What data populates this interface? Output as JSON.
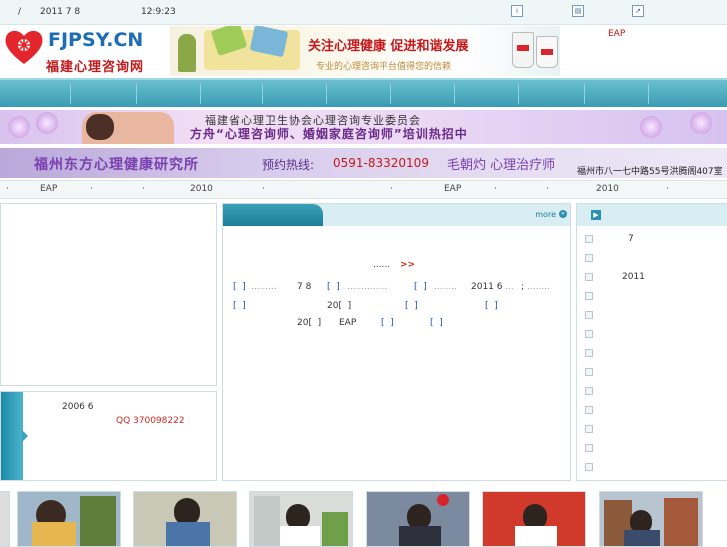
{
  "topbar": {
    "slash": "/",
    "date": "2011 7 8",
    "time": "12:9:23"
  },
  "header": {
    "logo_latin": "FJPSY.CN",
    "logo_chinese": "福建心理咨询网",
    "banner_slogan": "关注心理健康  促进和谐发展",
    "banner_sub": "专业的心理咨询平台值得您的信赖",
    "eap_link": "EAP"
  },
  "banner2": {
    "line1": "福建省心理卫生协会心理咨询专业委员会",
    "line2": "方舟“心理咨询师、婚姻家庭咨询师”培训热招中"
  },
  "banner3": {
    "institute": "福州东方心理健康研究所",
    "hotline_label": "预约热线:",
    "hotline": "0591-83320109",
    "doctor": "毛朝灼 心理治疗师",
    "address": "福州市八一七中路55号洪腾阁407室"
  },
  "ticker": {
    "items": [
      "EAP",
      "2010",
      "EAP",
      "2010"
    ]
  },
  "left_bottom": {
    "line1": "2006 6",
    "qq": "QQ 370098222"
  },
  "middle": {
    "more": "more",
    "ellipsis": "......",
    "arrows": ">>",
    "row1": {
      "a": "[  ]",
      "b": "7 8",
      "c": "[  ]",
      "d": "[  ]",
      "e": "2011 6",
      "f": ";"
    },
    "row2": {
      "a": "[  ]",
      "b": "20[  ]",
      "c": "[  ]",
      "d": "[  ]"
    },
    "row3": {
      "a": "20[  ]",
      "b": "EAP",
      "c": "[  ]",
      "d": "[  ]"
    }
  },
  "right": {
    "items": [
      "7",
      "",
      "2011",
      "",
      "",
      "",
      "",
      "",
      "",
      "",
      "",
      "",
      ""
    ]
  },
  "colors": {
    "nav": "#3a9bb2",
    "accent_red": "#d0271f",
    "link_blue": "#1c55b0"
  }
}
